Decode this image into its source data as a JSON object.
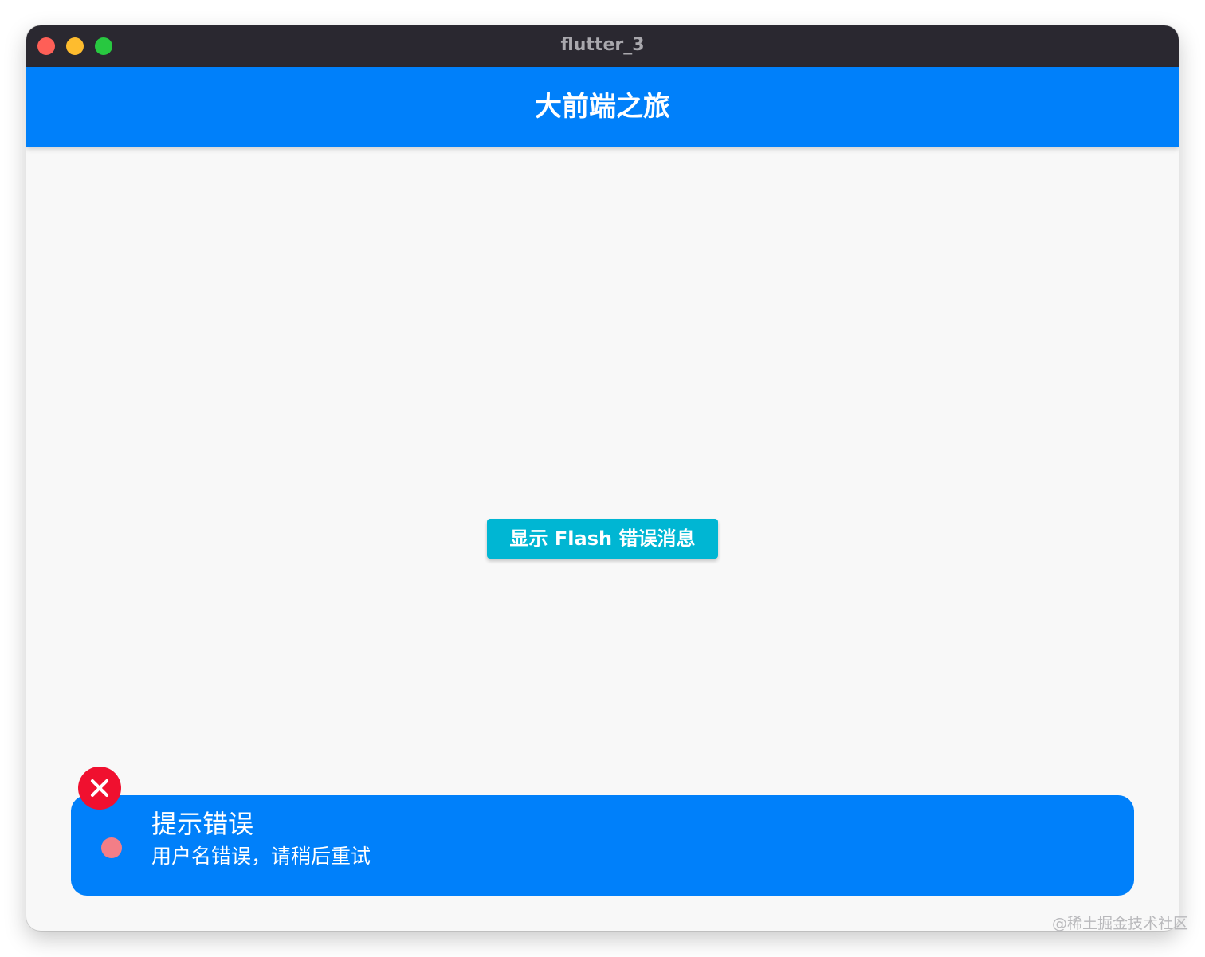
{
  "window": {
    "title": "flutter_3"
  },
  "appbar": {
    "title": "大前端之旅"
  },
  "main": {
    "button_label": "显示 Flash 错误消息"
  },
  "flash": {
    "title": "提示错误",
    "message": "用户名错误，请稍后重试",
    "close_icon": "close-icon",
    "indicator_color": "#f37e87",
    "background_color": "#0080fa",
    "close_color": "#f0102f"
  },
  "watermark": {
    "text": "@稀土掘金技术社区"
  },
  "colors": {
    "accent": "#0080fa",
    "button": "#00b6d3",
    "titlebar": "#2a2830"
  }
}
